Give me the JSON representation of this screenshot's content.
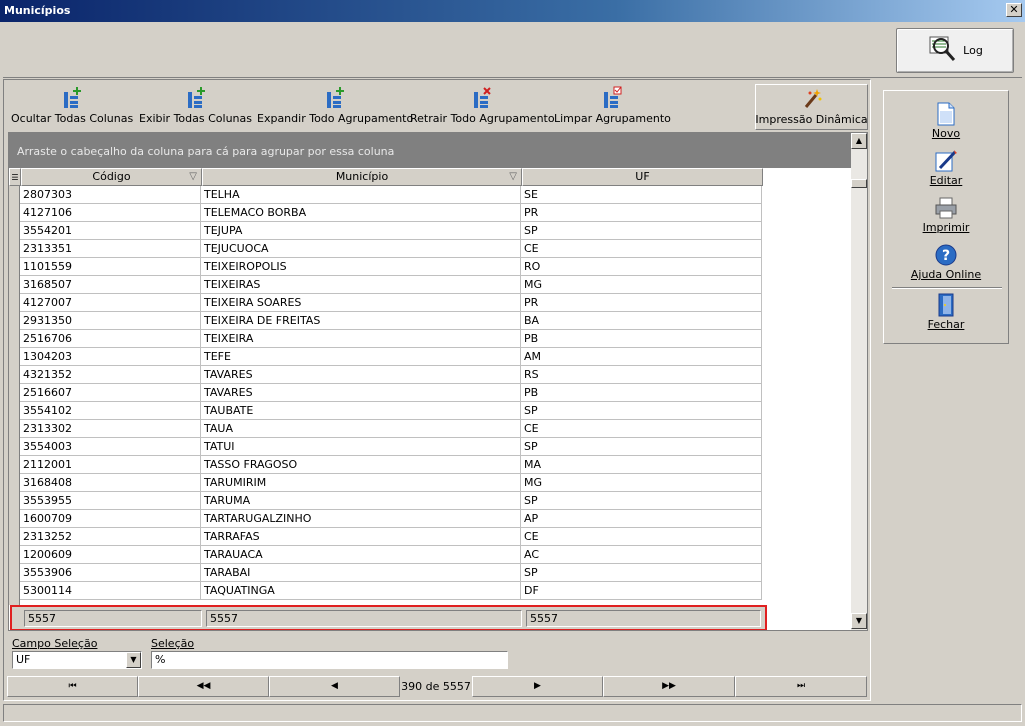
{
  "window": {
    "title": "Municípios",
    "close_glyph": "✕"
  },
  "log_button": {
    "label": "Log",
    "icon": "log-magnifier-icon"
  },
  "toolbar": {
    "hide_cols": "Ocultar Todas Colunas",
    "show_cols": "Exibir Todas  Colunas",
    "expand_group": "Expandir Todo Agrupamento",
    "collapse_group": "Retrair Todo Agrupamento",
    "clear_group": "Limpar Agrupamento",
    "dynamic_print": "Impressão Dinâmica"
  },
  "grid": {
    "group_hint": "Arraste o cabeçalho da coluna para cá para agrupar por essa coluna",
    "columns": [
      "Código",
      "Município",
      "UF"
    ],
    "rows": [
      [
        "2807303",
        "TELHA",
        "SE"
      ],
      [
        "4127106",
        "TELEMACO BORBA",
        "PR"
      ],
      [
        "3554201",
        "TEJUPA",
        "SP"
      ],
      [
        "2313351",
        "TEJUCUOCA",
        "CE"
      ],
      [
        "1101559",
        "TEIXEIROPOLIS",
        "RO"
      ],
      [
        "3168507",
        "TEIXEIRAS",
        "MG"
      ],
      [
        "4127007",
        "TEIXEIRA SOARES",
        "PR"
      ],
      [
        "2931350",
        "TEIXEIRA DE FREITAS",
        "BA"
      ],
      [
        "2516706",
        "TEIXEIRA",
        "PB"
      ],
      [
        "1304203",
        "TEFE",
        "AM"
      ],
      [
        "4321352",
        "TAVARES",
        "RS"
      ],
      [
        "2516607",
        "TAVARES",
        "PB"
      ],
      [
        "3554102",
        "TAUBATE",
        "SP"
      ],
      [
        "2313302",
        "TAUA",
        "CE"
      ],
      [
        "3554003",
        "TATUI",
        "SP"
      ],
      [
        "2112001",
        "TASSO FRAGOSO",
        "MA"
      ],
      [
        "3168408",
        "TARUMIRIM",
        "MG"
      ],
      [
        "3553955",
        "TARUMA",
        "SP"
      ],
      [
        "1600709",
        "TARTARUGALZINHO",
        "AP"
      ],
      [
        "2313252",
        "TARRAFAS",
        "CE"
      ],
      [
        "1200609",
        "TARAUACA",
        "AC"
      ],
      [
        "3553906",
        "TARABAI",
        "SP"
      ],
      [
        "5300114",
        "TAQUATINGA",
        "DF"
      ]
    ],
    "footer": [
      "5557",
      "5557",
      "5557"
    ]
  },
  "selection": {
    "field_label": "Campo Seleção",
    "field_value": "UF",
    "value_label": "Seleção",
    "value": "%"
  },
  "navigation": {
    "first": "⏮",
    "prev_page": "◀◀",
    "prev": "◀",
    "position": "390 de 5557",
    "next": "▶",
    "next_page": "▶▶",
    "last": "⏭"
  },
  "side_menu": {
    "new": "Novo",
    "edit": "Editar",
    "print": "Imprimir",
    "help": "Ajuda Online",
    "close": "Fechar"
  },
  "colors": {
    "title_bar": "#0a246a",
    "highlight_border": "#e02020",
    "group_bar": "#808080"
  }
}
